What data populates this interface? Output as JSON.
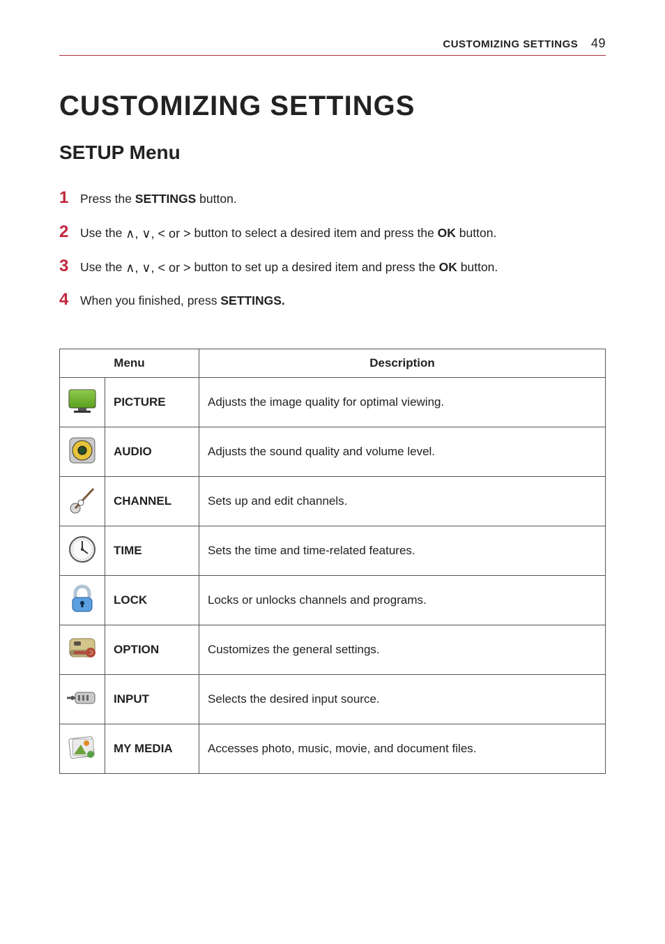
{
  "header": {
    "section": "CUSTOMIZING SETTINGS",
    "page_number": "49"
  },
  "title": "CUSTOMIZING SETTINGS",
  "subtitle": "SETUP Menu",
  "steps": {
    "s1": {
      "num": "1",
      "pre": "Press the ",
      "bold": "SETTINGS",
      "post": " button."
    },
    "s2": {
      "num": "2",
      "pre": "Use the ",
      "arrows": "∧, ∨, < or >",
      "mid": " button to select a desired item and press the ",
      "bold": "OK",
      "post": " button."
    },
    "s3": {
      "num": "3",
      "pre": "Use the ",
      "arrows": "∧, ∨, < or >",
      "mid": " button to set up a desired item and press the ",
      "bold": "OK",
      "post": " button."
    },
    "s4": {
      "num": "4",
      "pre": "When you finished, press ",
      "bold": "SETTINGS.",
      "post": ""
    }
  },
  "table": {
    "head_menu": "Menu",
    "head_desc": "Description",
    "rows": [
      {
        "icon": "picture-icon",
        "label": "PICTURE",
        "desc": "Adjusts the image quality for optimal viewing."
      },
      {
        "icon": "audio-icon",
        "label": "AUDIO",
        "desc": "Adjusts the sound quality and volume level."
      },
      {
        "icon": "channel-icon",
        "label": "CHANNEL",
        "desc": "Sets up and edit channels."
      },
      {
        "icon": "time-icon",
        "label": "TIME",
        "desc": "Sets the time and time-related features."
      },
      {
        "icon": "lock-icon",
        "label": "LOCK",
        "desc": "Locks or unlocks channels and programs."
      },
      {
        "icon": "option-icon",
        "label": "OPTION",
        "desc": "Customizes the general settings."
      },
      {
        "icon": "input-icon",
        "label": "INPUT",
        "desc": "Selects the desired input source."
      },
      {
        "icon": "mymedia-icon",
        "label": "MY MEDIA",
        "desc": "Accesses photo, music, movie, and document files."
      }
    ]
  }
}
